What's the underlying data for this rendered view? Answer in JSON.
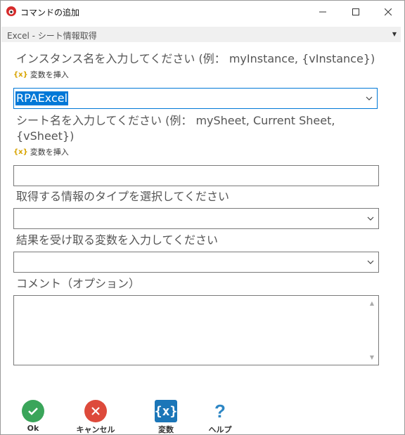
{
  "window": {
    "title": "コマンドの追加",
    "controls": {
      "minimize": "minimize-icon",
      "maximize": "maximize-icon",
      "close": "close-icon"
    }
  },
  "command": {
    "name": "Excel - シート情報取得"
  },
  "fields": {
    "instance": {
      "label": "インスタンス名を入力してください (例： myInstance, {vInstance})",
      "var_link": "変数を挿入",
      "value": "RPAExcel"
    },
    "sheet": {
      "label": "シート名を入力してください (例： mySheet, Current Sheet, {vSheet})",
      "var_link": "変数を挿入",
      "value": ""
    },
    "info_type": {
      "label": "取得する情報のタイプを選択してください",
      "value": ""
    },
    "result_var": {
      "label": "結果を受け取る変数を入力してください",
      "value": ""
    },
    "comment": {
      "label": "コメント（オプション）",
      "value": ""
    }
  },
  "buttons": {
    "ok": "Ok",
    "cancel": "キャンセル",
    "variables": "変数",
    "help": "ヘルプ"
  },
  "colors": {
    "accent": "#0078d7",
    "ok": "#3aa55a",
    "cancel": "#dd4a3b",
    "variables": "#1b76b8",
    "help": "#2d86c4",
    "var_icon": "#d8a400"
  }
}
